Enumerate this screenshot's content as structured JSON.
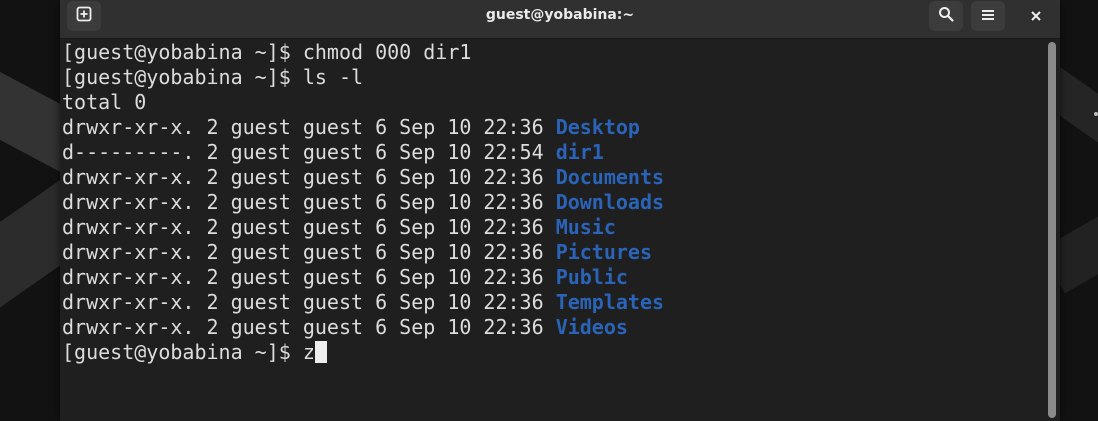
{
  "window": {
    "title": "guest@yobabina:~"
  },
  "icons": {
    "new_tab": "new-tab-icon",
    "search": "search-icon",
    "menu": "hamburger-menu-icon",
    "close": "close-icon"
  },
  "colors": {
    "directory": "#2a64b8",
    "text": "#dcdcdc",
    "background": "#1f1f1f",
    "titlebar": "#303030"
  },
  "terminal": {
    "lines": [
      {
        "text": "[guest@yobabina ~]$ chmod 000 dir1"
      },
      {
        "text": "[guest@yobabina ~]$ ls -l"
      },
      {
        "text": "total 0"
      },
      {
        "perms": "drwxr-xr-x. 2 guest guest 6 Sep 10 22:36 ",
        "name": "Desktop"
      },
      {
        "perms": "d---------. 2 guest guest 6 Sep 10 22:54 ",
        "name": "dir1"
      },
      {
        "perms": "drwxr-xr-x. 2 guest guest 6 Sep 10 22:36 ",
        "name": "Documents"
      },
      {
        "perms": "drwxr-xr-x. 2 guest guest 6 Sep 10 22:36 ",
        "name": "Downloads"
      },
      {
        "perms": "drwxr-xr-x. 2 guest guest 6 Sep 10 22:36 ",
        "name": "Music"
      },
      {
        "perms": "drwxr-xr-x. 2 guest guest 6 Sep 10 22:36 ",
        "name": "Pictures"
      },
      {
        "perms": "drwxr-xr-x. 2 guest guest 6 Sep 10 22:36 ",
        "name": "Public"
      },
      {
        "perms": "drwxr-xr-x. 2 guest guest 6 Sep 10 22:36 ",
        "name": "Templates"
      },
      {
        "perms": "drwxr-xr-x. 2 guest guest 6 Sep 10 22:36 ",
        "name": "Videos"
      }
    ],
    "prompt": "[guest@yobabina ~]$ ",
    "current_input": "z"
  }
}
